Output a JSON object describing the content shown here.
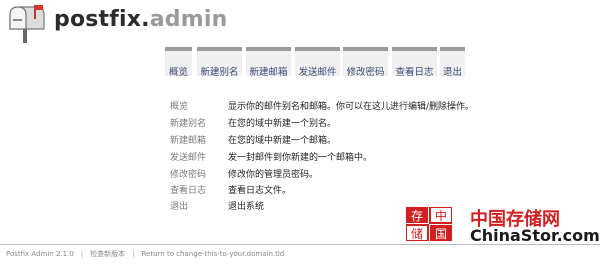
{
  "header": {
    "logo_text_dark": "postfix.",
    "logo_text_light": "admin"
  },
  "menu": [
    {
      "label": "概览"
    },
    {
      "label": "新建别名"
    },
    {
      "label": "新建邮箱"
    },
    {
      "label": "发送邮件"
    },
    {
      "label": "修改密码"
    },
    {
      "label": "查看日志"
    },
    {
      "label": "退出"
    }
  ],
  "overview": [
    {
      "label": "概览",
      "text": "显示你的邮件别名和邮箱。你可以在这儿进行编辑/删除操作。"
    },
    {
      "label": "新建别名",
      "text": "在您的域中新建一个别名。"
    },
    {
      "label": "新建邮箱",
      "text": "在您的域中新建一个邮箱。"
    },
    {
      "label": "发送邮件",
      "text": "发一封邮件到你新建的一个邮箱中。"
    },
    {
      "label": "修改密码",
      "text": "修改你的管理员密码。"
    },
    {
      "label": "查看日志",
      "text": "查看日志文件。"
    },
    {
      "label": "退出",
      "text": "退出系统"
    }
  ],
  "footer": {
    "version": "Postfix Admin 2.1.0",
    "check_update": "检查新版本",
    "return_link": "Return to change-this-to-your.domain.tld"
  },
  "watermark": {
    "cn": "中国存储网",
    "en": "ChinaStor.com",
    "stamp_chars": [
      "存",
      "储",
      "中",
      "国"
    ]
  }
}
